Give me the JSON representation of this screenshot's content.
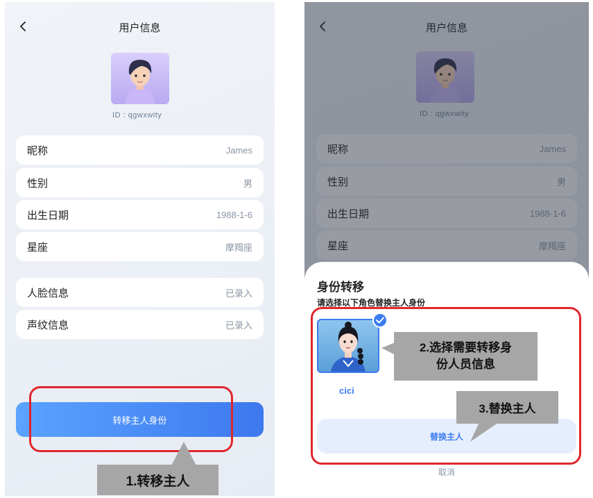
{
  "left_screen": {
    "header": {
      "title": "用户信息"
    },
    "user_id": "ID : qgwxwity",
    "profile_rows": [
      {
        "label": "昵称",
        "value": "James"
      },
      {
        "label": "性别",
        "value": "男"
      },
      {
        "label": "出生日期",
        "value": "1988-1-6"
      },
      {
        "label": "星座",
        "value": "摩羯座"
      }
    ],
    "record_rows": [
      {
        "label": "人脸信息",
        "value": "已录入"
      },
      {
        "label": "声纹信息",
        "value": "已录入"
      }
    ],
    "transfer_button": "转移主人身份"
  },
  "right_screen": {
    "header": {
      "title": "用户信息"
    },
    "user_id": "ID : qgwxwity",
    "profile_rows": [
      {
        "label": "昵称",
        "value": "James"
      },
      {
        "label": "性别",
        "value": "男"
      },
      {
        "label": "出生日期",
        "value": "1988-1-6"
      },
      {
        "label": "星座",
        "value": "摩羯座"
      }
    ],
    "sheet": {
      "title": "身份转移",
      "subtitle": "请选择以下角色替换主人身份",
      "candidate_name": "cici",
      "replace_button": "替换主人",
      "cancel": "取消"
    }
  },
  "annotations": {
    "step1": "1.转移主人",
    "step2_line1": "2.选择需要转移身",
    "step2_line2": "份人员信息",
    "step3": "3.替换主人",
    "frame_color": "#e0262c",
    "tag_color": "#a6a6a6"
  },
  "colors": {
    "accent": "#3d7bf0",
    "button_gradient_start": "#5aa4ff",
    "button_gradient_end": "#3d78ee"
  }
}
